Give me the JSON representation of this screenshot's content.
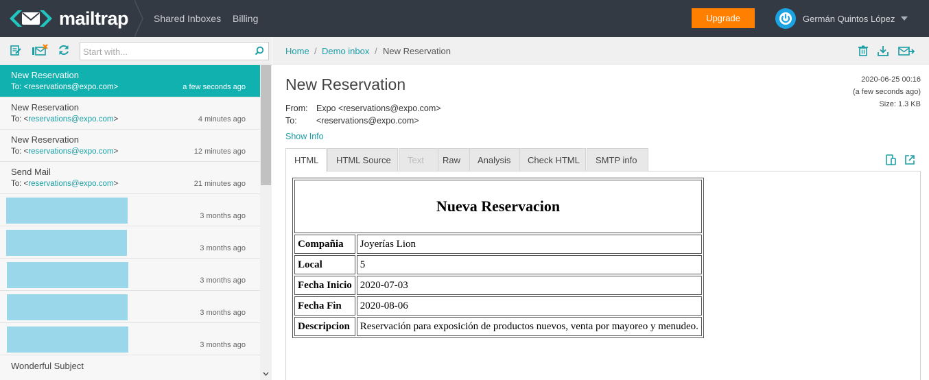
{
  "brand": {
    "name": "mailtrap"
  },
  "topnav": {
    "links": [
      "Shared Inboxes",
      "Billing"
    ],
    "upgrade_label": "Upgrade",
    "user_name": "Germán Quintos López"
  },
  "toolbar": {
    "search_placeholder": "Start with..."
  },
  "messages": [
    {
      "subject": "New Reservation",
      "to_prefix": "To: <",
      "email": "reservations@expo.com",
      "to_suffix": ">",
      "time": "a few seconds ago",
      "active": true
    },
    {
      "subject": "New Reservation",
      "to_prefix": "To: <",
      "email": "reservations@expo.com",
      "to_suffix": ">",
      "time": "4 minutes ago"
    },
    {
      "subject": "New Reservation",
      "to_prefix": "To: <",
      "email": "reservations@expo.com",
      "to_suffix": ">",
      "time": "12 minutes ago"
    },
    {
      "subject": "Send Mail",
      "to_prefix": "To: <",
      "email": "reservations@expo.com",
      "to_suffix": ">",
      "time": "21 minutes ago"
    },
    {
      "redacted": true,
      "time": "3 months ago"
    },
    {
      "redacted": true,
      "time": "3 months ago"
    },
    {
      "redacted": true,
      "time": "3 months ago"
    },
    {
      "redacted": true,
      "time": "3 months ago"
    },
    {
      "redacted": true,
      "time": "3 months ago"
    },
    {
      "subject": "Wonderful Subject"
    }
  ],
  "breadcrumb": {
    "home": "Home",
    "inbox": "Demo inbox",
    "current": "New Reservation",
    "sep": "/"
  },
  "message": {
    "subject": "New Reservation",
    "datetime": "2020-06-25 00:16",
    "relative": "(a few seconds ago)",
    "size": "Size: 1.3 KB",
    "from_label": "From:",
    "from_value": "Expo <reservations@expo.com>",
    "to_label": "To:",
    "to_value": "<reservations@expo.com>",
    "show_info": "Show Info"
  },
  "tabs": [
    "HTML",
    "HTML Source",
    "Text",
    "Raw",
    "Analysis",
    "Check HTML",
    "SMTP info"
  ],
  "email_body": {
    "title": "Nueva Reservacion",
    "rows": [
      {
        "key": "Compañia",
        "value": "Joyerías Lion"
      },
      {
        "key": "Local",
        "value": "5"
      },
      {
        "key": "Fecha Inicio",
        "value": "2020-07-03"
      },
      {
        "key": "Fecha Fin",
        "value": "2020-08-06"
      },
      {
        "key": "Descripcion",
        "value": "Reservación para exposición de productos nuevos, venta por mayoreo y menudeo."
      }
    ]
  },
  "colors": {
    "accent": "#11b1b0",
    "nav_bg": "#343a44",
    "upgrade": "#ff7f00",
    "link": "#1a9ea5"
  }
}
